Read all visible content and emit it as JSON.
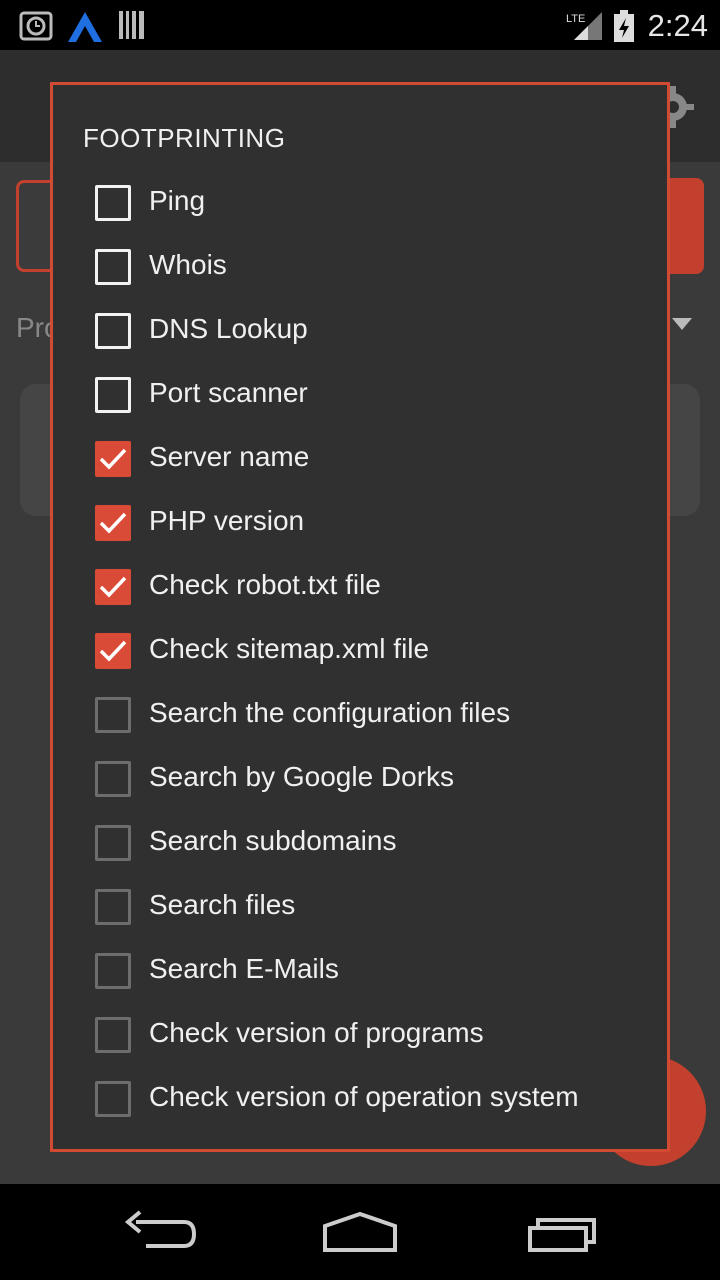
{
  "status_bar": {
    "time": "2:24",
    "network": "LTE",
    "icons": [
      "alarm-icon",
      "app-a-icon",
      "barcode-icon",
      "signal-icon",
      "battery-icon"
    ]
  },
  "background": {
    "label_partial": "Pro",
    "accent": "#c2402d"
  },
  "dialog": {
    "title": "FOOTPRINTING",
    "accent": "#d14a32",
    "items": [
      {
        "label": "Ping",
        "checked": false
      },
      {
        "label": "Whois",
        "checked": false
      },
      {
        "label": "DNS Lookup",
        "checked": false
      },
      {
        "label": "Port scanner",
        "checked": false
      },
      {
        "label": "Server name",
        "checked": true
      },
      {
        "label": "PHP version",
        "checked": true
      },
      {
        "label": "Check robot.txt file",
        "checked": true
      },
      {
        "label": "Check sitemap.xml file",
        "checked": true
      },
      {
        "label": "Search the configuration files",
        "checked": false
      },
      {
        "label": "Search by Google Dorks",
        "checked": false
      },
      {
        "label": "Search subdomains",
        "checked": false
      },
      {
        "label": "Search files",
        "checked": false
      },
      {
        "label": "Search E-Mails",
        "checked": false
      },
      {
        "label": "Check version of programs",
        "checked": false
      },
      {
        "label": "Check version of operation system",
        "checked": false
      }
    ]
  },
  "nav_bar": {
    "icons": [
      "back-icon",
      "home-icon",
      "recents-icon"
    ]
  }
}
